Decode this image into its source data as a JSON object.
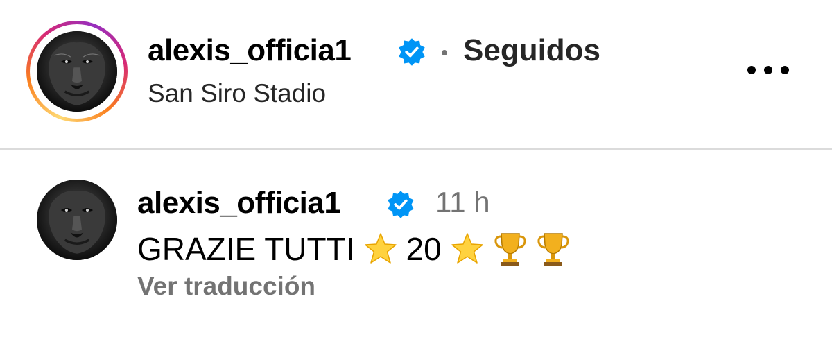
{
  "post_header": {
    "username": "alexis_officia1",
    "follow_status": "Seguidos",
    "location": "San Siro Stadio"
  },
  "caption_comment": {
    "username": "alexis_officia1",
    "timestamp": "11 h",
    "text_part1": "GRAZIE TUTTI",
    "text_part2": "20",
    "translate_label": "Ver traducción"
  },
  "icons": {
    "verified_color": "#0095f6",
    "more": "more-options-icon",
    "verified": "verified-badge-icon"
  },
  "colors": {
    "secondary_text": "#737373",
    "divider": "#dbdbdb"
  }
}
